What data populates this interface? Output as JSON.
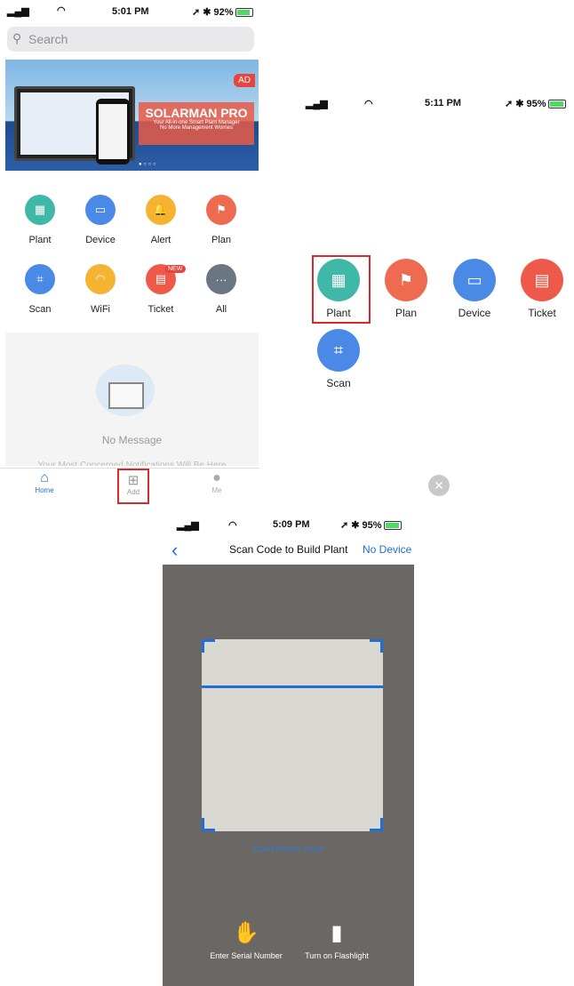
{
  "panel1": {
    "status": {
      "time": "5:01 PM",
      "battery": "92%"
    },
    "search_placeholder": "Search",
    "banner": {
      "ad": "AD",
      "title": "SOLARMAN PRO",
      "line1": "Your All-in-one Smart Plant Manager",
      "line2": "No More Management Worries"
    },
    "grid": [
      {
        "label": "Plant",
        "color": "#3fb8a8"
      },
      {
        "label": "Device",
        "color": "#4a8ae6"
      },
      {
        "label": "Alert",
        "color": "#f5b331"
      },
      {
        "label": "Plan",
        "color": "#ee6a50"
      },
      {
        "label": "Scan",
        "color": "#4a8ae6"
      },
      {
        "label": "WiFi",
        "color": "#f5b331"
      },
      {
        "label": "Ticket",
        "color": "#ee5a4a"
      },
      {
        "label": "All",
        "color": "#6b7683"
      }
    ],
    "new_badge": "NEW",
    "no_message": "No Message",
    "notice": "Your Most Concerned Notifications Will Be Here",
    "tabs": {
      "home": "Home",
      "add": "Add",
      "me": "Me"
    }
  },
  "panel2": {
    "status": {
      "time": "5:11 PM",
      "battery": "95%"
    },
    "items": [
      {
        "label": "Plant",
        "color": "#3fb8a8"
      },
      {
        "label": "Plan",
        "color": "#ee6a50"
      },
      {
        "label": "Device",
        "color": "#4a8ae6"
      },
      {
        "label": "Ticket",
        "color": "#ee5a4a"
      },
      {
        "label": "Scan",
        "color": "#4a8ae6"
      }
    ]
  },
  "panel3": {
    "status": {
      "time": "5:09 PM",
      "battery": "95%"
    },
    "title": "Scan Code to Build Plant",
    "no_device": "No Device",
    "hint": "Card frame scan",
    "enter_serial": "Enter Serial Number",
    "flashlight": "Turn on Flashlight"
  }
}
